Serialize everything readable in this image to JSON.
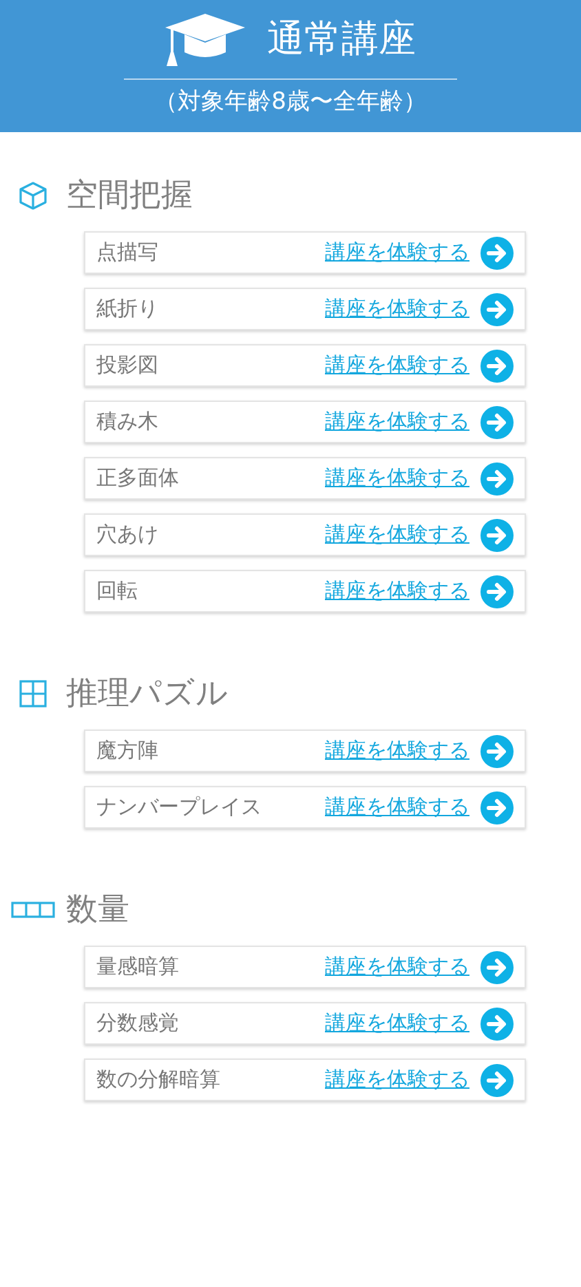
{
  "header": {
    "title": "通常講座",
    "subtitle": "（対象年齢8歳〜全年齢）"
  },
  "sections": [
    {
      "title": "空間把握",
      "courses": [
        {
          "name": "点描写",
          "link": "講座を体験する"
        },
        {
          "name": "紙折り",
          "link": "講座を体験する"
        },
        {
          "name": "投影図",
          "link": "講座を体験する"
        },
        {
          "name": "積み木",
          "link": "講座を体験する"
        },
        {
          "name": "正多面体",
          "link": "講座を体験する"
        },
        {
          "name": "穴あけ",
          "link": "講座を体験する"
        },
        {
          "name": "回転",
          "link": "講座を体験する"
        }
      ]
    },
    {
      "title": "推理パズル",
      "courses": [
        {
          "name": "魔方陣",
          "link": "講座を体験する"
        },
        {
          "name": "ナンバープレイス",
          "link": "講座を体験する"
        }
      ]
    },
    {
      "title": "数量",
      "courses": [
        {
          "name": "量感暗算",
          "link": "講座を体験する"
        },
        {
          "name": "分数感覚",
          "link": "講座を体験する"
        },
        {
          "name": "数の分解暗算",
          "link": "講座を体験する"
        }
      ]
    }
  ]
}
